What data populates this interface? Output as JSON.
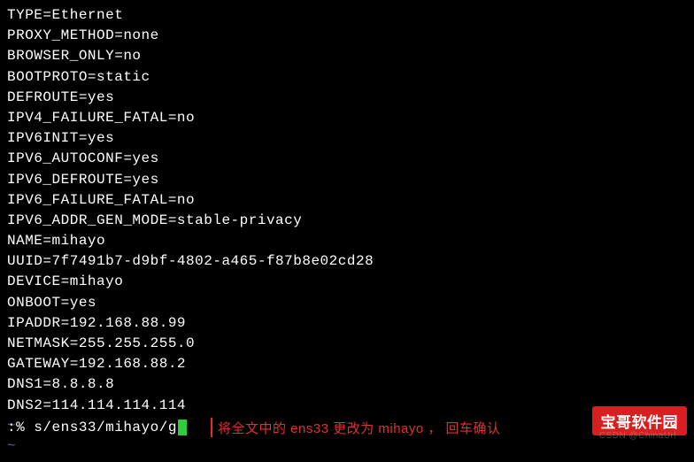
{
  "config_lines": [
    "TYPE=Ethernet",
    "PROXY_METHOD=none",
    "BROWSER_ONLY=no",
    "BOOTPROTO=static",
    "DEFROUTE=yes",
    "IPV4_FAILURE_FATAL=no",
    "IPV6INIT=yes",
    "IPV6_AUTOCONF=yes",
    "IPV6_DEFROUTE=yes",
    "IPV6_FAILURE_FATAL=no",
    "IPV6_ADDR_GEN_MODE=stable-privacy",
    "NAME=mihayo",
    "UUID=7f7491b7-d9bf-4802-a465-f87b8e02cd28",
    "DEVICE=mihayo",
    "ONBOOT=yes",
    "IPADDR=192.168.88.99",
    "NETMASK=255.255.255.0",
    "GATEWAY=192.168.88.2",
    "DNS1=8.8.8.8",
    "DNS2=114.114.114.114"
  ],
  "tildes": [
    "~",
    "~"
  ],
  "command": ":% s/ens33/mihayo/g",
  "annotation": "将全文中的 ens33 更改为 mihayo ， 回车确认",
  "watermark_logo": "宝哥软件园",
  "watermark_text": "CSDN @ChinaUrl"
}
